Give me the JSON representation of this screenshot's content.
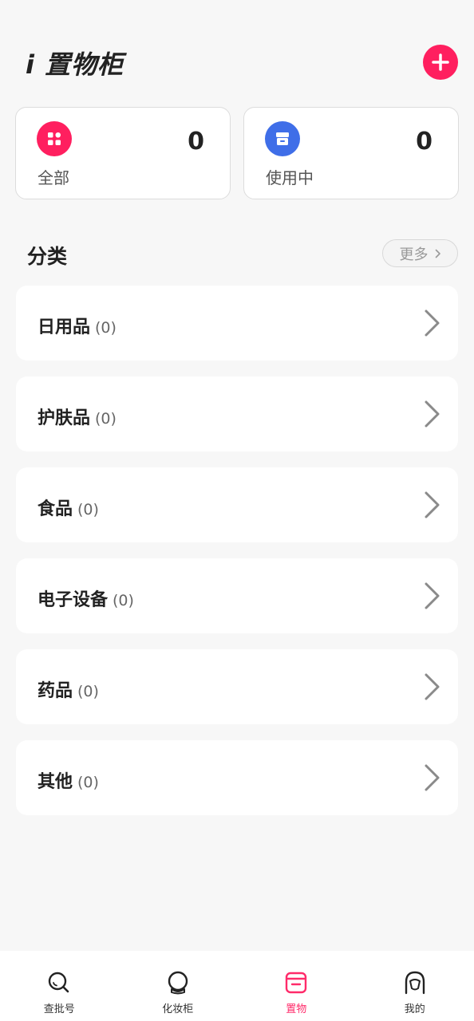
{
  "header": {
    "title": "置物柜",
    "title_prefix": "i"
  },
  "summary": [
    {
      "label": "全部",
      "count": "0",
      "icon": "grid-icon",
      "color": "#ff1f5f"
    },
    {
      "label": "使用中",
      "count": "0",
      "icon": "box-icon",
      "color": "#3f6ee8"
    }
  ],
  "section": {
    "title": "分类",
    "more_label": "更多"
  },
  "categories": [
    {
      "name": "日用品",
      "count": "(0)"
    },
    {
      "name": "护肤品",
      "count": "(0)"
    },
    {
      "name": "食品",
      "count": "(0)"
    },
    {
      "name": "电子设备",
      "count": "(0)"
    },
    {
      "name": "药品",
      "count": "(0)"
    },
    {
      "name": "其他",
      "count": "(0)"
    }
  ],
  "nav": [
    {
      "label": "查批号",
      "icon": "search-icon"
    },
    {
      "label": "化妆柜",
      "icon": "mirror-icon"
    },
    {
      "label": "置物",
      "icon": "cabinet-icon",
      "active": true
    },
    {
      "label": "我的",
      "icon": "profile-icon"
    }
  ],
  "colors": {
    "accent": "#ff1f5f",
    "blue": "#3f6ee8",
    "active_nav": "#ff2b6a"
  }
}
